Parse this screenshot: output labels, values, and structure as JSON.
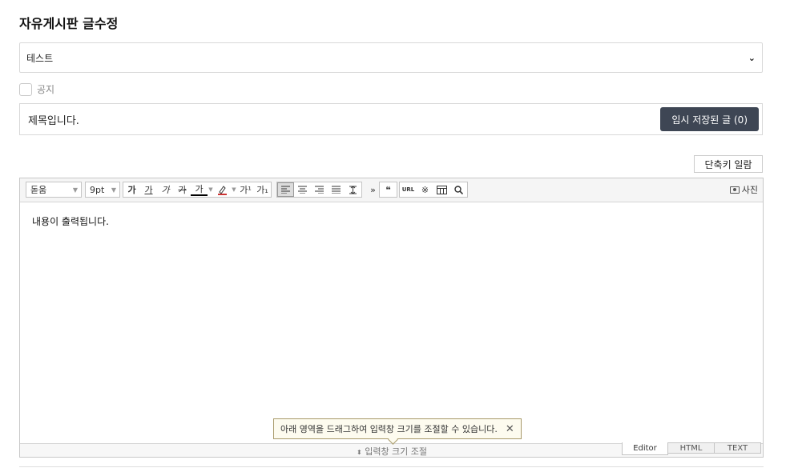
{
  "page": {
    "title": "자유게시판 글수정"
  },
  "board_select": {
    "value": "테스트"
  },
  "notice": {
    "label": "공지",
    "checked": false
  },
  "post_title": {
    "value": "제목입니다."
  },
  "temp_saved": {
    "label": "임시 저장된 글 (0)"
  },
  "shortcut": {
    "label": "단축키 일람"
  },
  "toolbar": {
    "font": "돋움",
    "size": "9pt",
    "bold": "가",
    "underline": "가",
    "italic": "가",
    "strike": "가",
    "font_color": "가",
    "superscript": "가¹",
    "subscript": "가₁",
    "quote": "❝",
    "url": "URL",
    "special": "※",
    "photo": "사진"
  },
  "editor": {
    "content": "내용이 출력됩니다."
  },
  "resize": {
    "label": "입력창 크기 조절",
    "tooltip": "아래 영역을 드래그하여 입력창 크기를 조절할 수 있습니다."
  },
  "modes": [
    "Editor",
    "HTML",
    "TEXT"
  ],
  "colors": {
    "temp_button_bg": "#3e4654",
    "tooltip_bg": "#fdfbef",
    "tooltip_border": "#a89a6a"
  }
}
